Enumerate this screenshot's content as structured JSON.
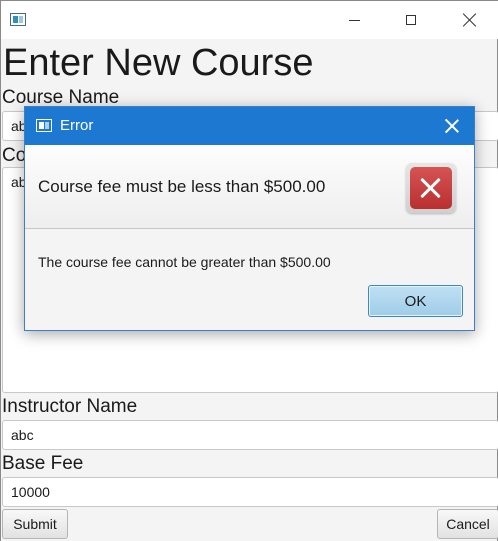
{
  "window": {
    "title": ""
  },
  "form": {
    "heading": "Enter New Course",
    "course_name": {
      "label": "Course Name",
      "value": "ab"
    },
    "course_desc": {
      "label": "Co",
      "value": "ab"
    },
    "instructor": {
      "label": "Instructor Name",
      "value": "abc"
    },
    "base_fee": {
      "label": "Base Fee",
      "value": "10000"
    },
    "submit_label": "Submit",
    "cancel_label": "Cancel"
  },
  "dialog": {
    "title": "Error",
    "header": "Course fee must be less than $500.00",
    "content": "The course fee cannot be greater than $500.00",
    "ok_label": "OK",
    "icon": "error-icon",
    "accent": "#1c78d0",
    "error_color": "#c94040"
  }
}
